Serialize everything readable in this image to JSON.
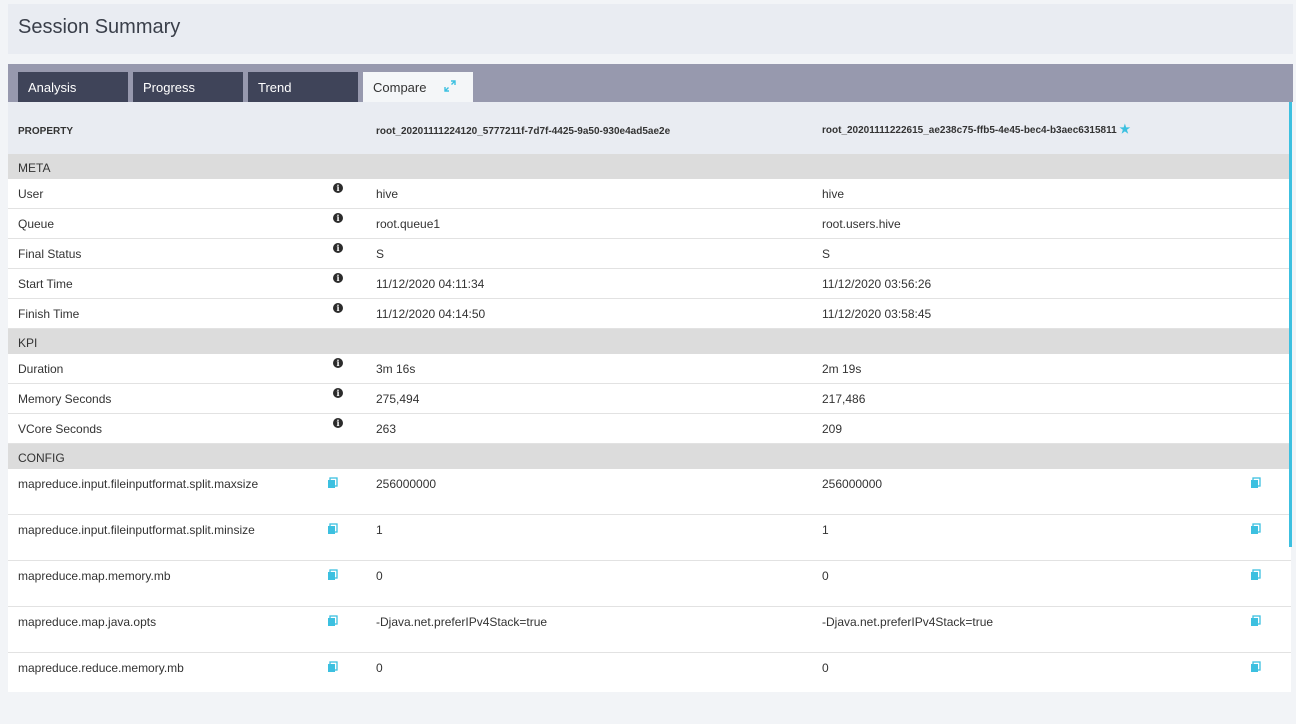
{
  "page": {
    "title": "Session Summary"
  },
  "tabs": [
    {
      "label": "Analysis"
    },
    {
      "label": "Progress"
    },
    {
      "label": "Trend"
    },
    {
      "label": "Compare"
    }
  ],
  "table": {
    "header": {
      "property": "PROPERTY",
      "app1": "root_20201111224120_5777211f-7d7f-4425-9a50-930e4ad5ae2e",
      "app2": "root_20201111222615_ae238c75-ffb5-4e45-bec4-b3aec6315811",
      "star": "★"
    },
    "sections": {
      "meta": "META",
      "kpi": "KPI",
      "config": "CONFIG"
    },
    "meta_rows": [
      {
        "name": "User",
        "v1": "hive",
        "v2": "hive"
      },
      {
        "name": "Queue",
        "v1": "root.queue1",
        "v2": "root.users.hive"
      },
      {
        "name": "Final Status",
        "v1": "S",
        "v2": "S"
      },
      {
        "name": "Start Time",
        "v1": "11/12/2020 04:11:34",
        "v2": "11/12/2020 03:56:26"
      },
      {
        "name": "Finish Time",
        "v1": "11/12/2020 04:14:50",
        "v2": "11/12/2020 03:58:45"
      }
    ],
    "kpi_rows": [
      {
        "name": "Duration",
        "v1": "3m 16s",
        "v2": "2m 19s"
      },
      {
        "name": "Memory Seconds",
        "v1": "275,494",
        "v2": "217,486"
      },
      {
        "name": "VCore Seconds",
        "v1": "263",
        "v2": "209"
      }
    ],
    "config_rows": [
      {
        "name": "mapreduce.input.fileinputformat.split.maxsize",
        "v1": "256000000",
        "v2": "256000000"
      },
      {
        "name": "mapreduce.input.fileinputformat.split.minsize",
        "v1": "1",
        "v2": "1"
      },
      {
        "name": "mapreduce.map.memory.mb",
        "v1": "0",
        "v2": "0"
      },
      {
        "name": "mapreduce.map.java.opts",
        "v1": "-Djava.net.preferIPv4Stack=true",
        "v2": "-Djava.net.preferIPv4Stack=true"
      },
      {
        "name": "mapreduce.reduce.memory.mb",
        "v1": "0",
        "v2": "0"
      }
    ]
  },
  "icons": {
    "info": "info-icon",
    "copy": "copy-icon",
    "expand": "expand-icon",
    "star": "star-icon"
  },
  "colors": {
    "accent": "#3cc0e0",
    "tab_dark": "#3f4459",
    "tab_strip": "#9799ae",
    "section_bg": "#dcdcdc"
  }
}
